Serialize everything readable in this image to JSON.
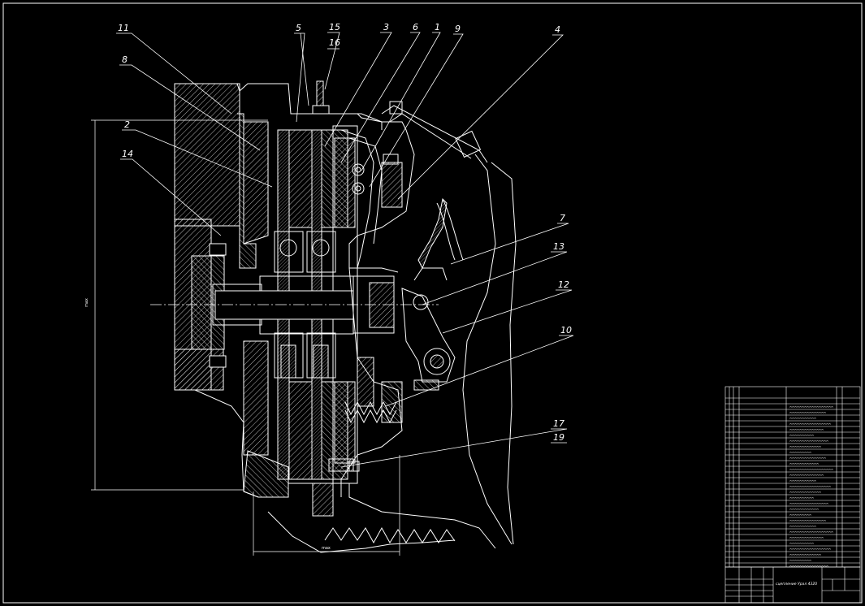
{
  "drawing": {
    "palette": {
      "background": "#000000",
      "lines": "#ffffff"
    },
    "callouts": [
      {
        "id": "c11",
        "text": "11"
      },
      {
        "id": "c8",
        "text": "8"
      },
      {
        "id": "c2",
        "text": "2"
      },
      {
        "id": "c14",
        "text": "14"
      },
      {
        "id": "c5",
        "text": "5"
      },
      {
        "id": "c15",
        "text": "15"
      },
      {
        "id": "c16",
        "text": "16"
      },
      {
        "id": "c3",
        "text": "3"
      },
      {
        "id": "c6",
        "text": "6"
      },
      {
        "id": "c1",
        "text": "1"
      },
      {
        "id": "c9",
        "text": "9"
      },
      {
        "id": "c4",
        "text": "4"
      },
      {
        "id": "c7",
        "text": "7"
      },
      {
        "id": "c13",
        "text": "13"
      },
      {
        "id": "c12",
        "text": "12"
      },
      {
        "id": "c10",
        "text": "10"
      },
      {
        "id": "c17",
        "text": "17"
      },
      {
        "id": "c19",
        "text": "19"
      }
    ],
    "dimensions": {
      "vertical": "max",
      "horizontal": "max"
    }
  },
  "title_block": {
    "title": "сцепление Урал 4320"
  }
}
